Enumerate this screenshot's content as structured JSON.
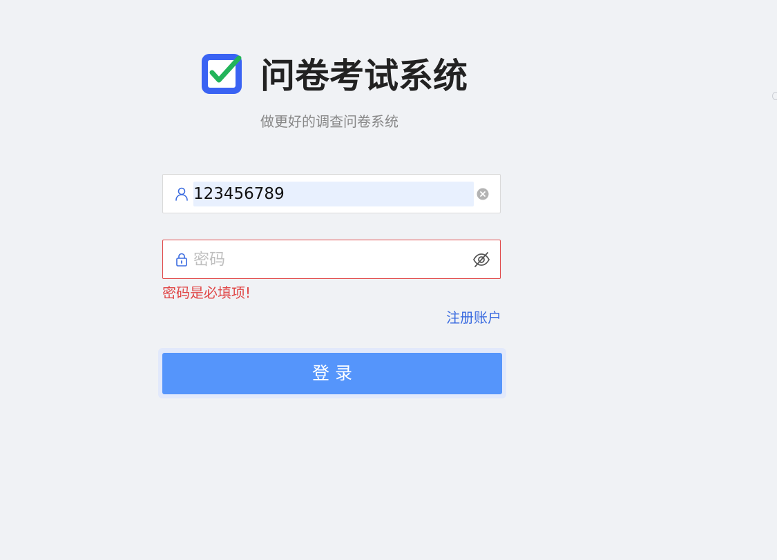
{
  "header": {
    "title": "问卷考试系统",
    "subtitle": "做更好的调查问卷系统",
    "logo_icon": "checkbox-icon"
  },
  "form": {
    "username": {
      "value": "123456789",
      "prefix_icon": "user-icon",
      "suffix_icon": "clear-icon"
    },
    "password": {
      "placeholder": "密码",
      "value": "",
      "prefix_icon": "lock-icon",
      "suffix_icon": "eye-invisible-icon"
    },
    "error_text": "密码是必填项!",
    "register_link": "注册账户",
    "login_button": "登录"
  },
  "colors": {
    "background": "#f0f2f5",
    "primary": "#5595fb",
    "link": "#3a6be0",
    "error": "#e04646",
    "logo_blue": "#3a63f3",
    "logo_check": "#22b45a"
  }
}
